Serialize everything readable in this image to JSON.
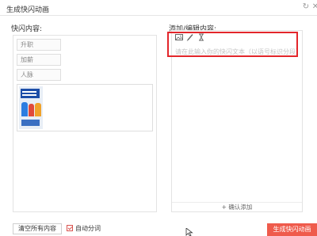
{
  "window": {
    "title": "生成快闪动画",
    "icons": [
      "refresh-icon",
      "close-icon"
    ]
  },
  "left": {
    "label": "快闪内容:",
    "tags": [
      "升职",
      "加薪",
      "人脉"
    ],
    "media_icon": "poster-thumbnail"
  },
  "right": {
    "label": "添加/编辑内容:",
    "tools": [
      "image-icon",
      "pen-icon",
      "hourglass-icon"
    ],
    "placeholder": "请在此输入你的快闪文本（以语号标识分段）",
    "confirm_label": "+ 确认添加"
  },
  "footer": {
    "clear_label": "清空所有内容",
    "auto_split_label": "自动分词",
    "auto_split_checked": true,
    "generate_label": "生成快闪动画"
  },
  "colors": {
    "accent": "#ef5b4c",
    "highlight": "#e3262b",
    "border": "#e3e3e3"
  }
}
